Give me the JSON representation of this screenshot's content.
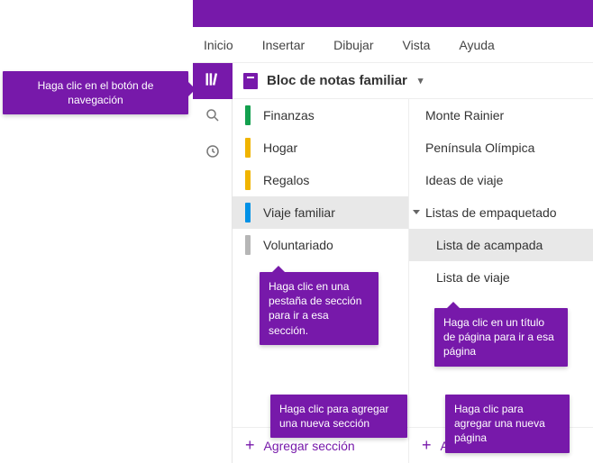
{
  "ribbon": {
    "inicio": "Inicio",
    "insertar": "Insertar",
    "dibujar": "Dibujar",
    "vista": "Vista",
    "ayuda": "Ayuda"
  },
  "notebook": {
    "title": "Bloc de notas familiar"
  },
  "sections": {
    "items": [
      {
        "label": "Finanzas",
        "color": "#13a04e"
      },
      {
        "label": "Hogar",
        "color": "#f0b400"
      },
      {
        "label": "Regalos",
        "color": "#f0b400"
      },
      {
        "label": "Viaje familiar",
        "color": "#0091e6"
      },
      {
        "label": "Voluntariado",
        "color": "#b6b6b6"
      }
    ],
    "add": "Agregar sección"
  },
  "pages": {
    "items": [
      {
        "label": "Monte Rainier"
      },
      {
        "label": "Península Olímpica"
      },
      {
        "label": "Ideas de viaje"
      },
      {
        "label": "Listas de empaquetado"
      },
      {
        "label": "Lista de acampada"
      },
      {
        "label": "Lista de viaje"
      }
    ],
    "add": "Agregar página"
  },
  "tips": {
    "nav": "Haga clic en el botón de navegación",
    "section": "Haga clic en una pestaña de sección para ir a esa sección.",
    "page": "Haga clic en un título de página para ir a esa página",
    "addsection": "Haga clic para agregar una nueva sección",
    "addpage": "Haga clic para agregar una nueva página"
  }
}
